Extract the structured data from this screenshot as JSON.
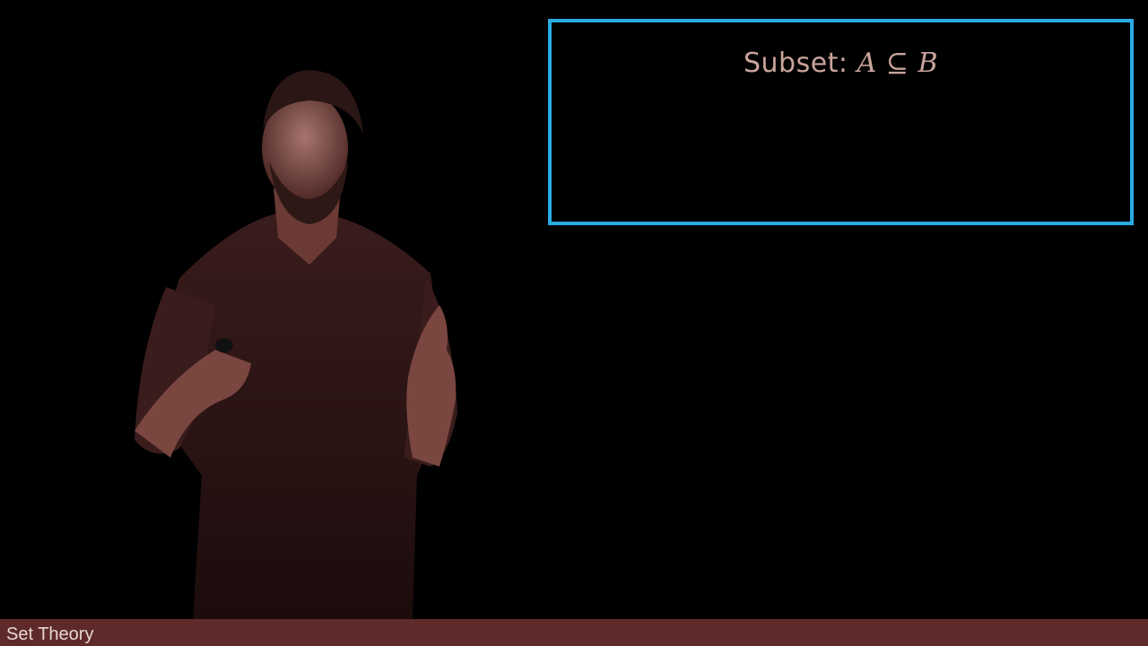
{
  "definition": {
    "title_word": "Subset:",
    "title_math": "A ⊆ B"
  },
  "footer": {
    "label": "Set Theory"
  },
  "colors": {
    "background": "#000000",
    "box_border": "#29abe2",
    "title_text": "#c9a49a",
    "footer_bar": "#5e2a2a",
    "footer_text": "#e8d6d2"
  }
}
